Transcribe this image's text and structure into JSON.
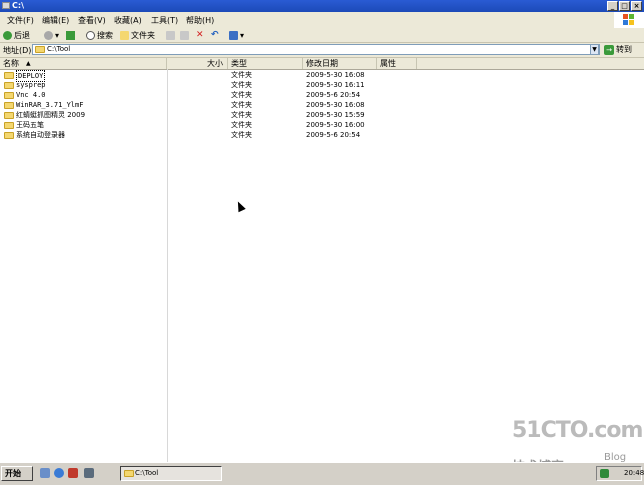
{
  "window": {
    "title": "C:\\"
  },
  "menu": [
    "文件(F)",
    "编辑(E)",
    "查看(V)",
    "收藏(A)",
    "工具(T)",
    "帮助(H)"
  ],
  "toolbar": {
    "back_label": "后退",
    "search_label": "搜索",
    "folders_label": "文件夹"
  },
  "address": {
    "label": "地址(D)",
    "value": "C:\\Tool",
    "go_label": "转到"
  },
  "columns": {
    "name": "名称",
    "size": "大小",
    "type": "类型",
    "modified": "修改日期",
    "attributes": "属性"
  },
  "files": [
    {
      "name": "DEPLOY",
      "type": "文件夹",
      "modified": "2009-5-30 16:08"
    },
    {
      "name": "sysprep",
      "type": "文件夹",
      "modified": "2009-5-30 16:11"
    },
    {
      "name": "Vnc 4.0",
      "type": "文件夹",
      "modified": "2009-5-6 20:54"
    },
    {
      "name": "WinRAR_3.71_YlmF",
      "type": "文件夹",
      "modified": "2009-5-30 16:08"
    },
    {
      "name": "红蜻蜓抓图精灵 2009",
      "type": "文件夹",
      "modified": "2009-5-30 15:59"
    },
    {
      "name": "王码五笔",
      "type": "文件夹",
      "modified": "2009-5-30 16:00"
    },
    {
      "name": "系统自动登录器",
      "type": "文件夹",
      "modified": "2009-5-6 20:54"
    }
  ],
  "taskbar": {
    "start_label": "开始",
    "task_label": "C:\\Tool",
    "clock": "20:48"
  },
  "watermark": {
    "site": "51CTO.com",
    "caption": "技术博客",
    "blog": "Blog"
  }
}
